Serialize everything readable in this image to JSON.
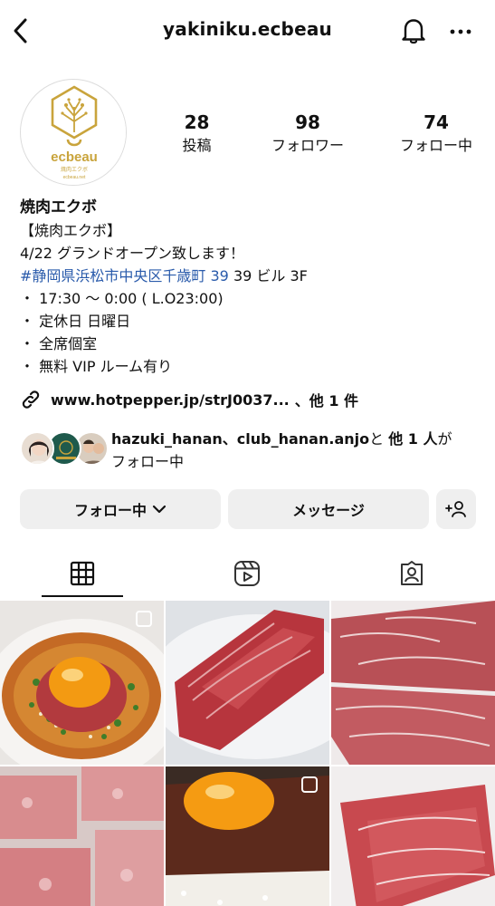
{
  "header": {
    "username": "yakiniku.ecbeau",
    "back_icon": "chevron-left-icon",
    "bell_icon": "bell-icon",
    "more_icon": "more-horizontal-icon"
  },
  "profile": {
    "avatar_icon": "ecbeau-logo",
    "stats": [
      {
        "num": "28",
        "label": "投稿"
      },
      {
        "num": "98",
        "label": "フォロワー"
      },
      {
        "num": "74",
        "label": "フォロー中"
      }
    ]
  },
  "bio": {
    "name": "焼肉エクボ",
    "lines": [
      "【焼肉エクボ】",
      "4/22 グランドオープン致します！",
      "・ 17:30 〜 0:00 ( L.O23:00)",
      "・ 定休日 日曜日",
      "・ 全席個室",
      "・ 無料 VIP ルーム有り"
    ],
    "hashtag": "#静岡県浜松市中央区千歳町 39",
    "hashtag_rest": " 39 ビル 3F"
  },
  "link": {
    "icon": "link-icon",
    "text": "www.hotpepper.jp/strJ0037...",
    "extra": "、他 1 件"
  },
  "followed_by": {
    "users": "hazuki_hanan、club_hanan.anjo",
    "conj": "と",
    "others": "他 1 人",
    "suffix": "が",
    "line2": "フォロー中"
  },
  "actions": {
    "follow_label": "フォロー中",
    "message_label": "メッセージ",
    "add_icon": "add-person-icon",
    "chevron_icon": "chevron-down-icon"
  },
  "tabs": {
    "items": [
      "grid-icon",
      "reels-icon",
      "tagged-icon"
    ]
  },
  "colors": {
    "accent_link": "#2a5bab",
    "button_bg": "#efefef",
    "logo_gold": "#c9a43c"
  }
}
